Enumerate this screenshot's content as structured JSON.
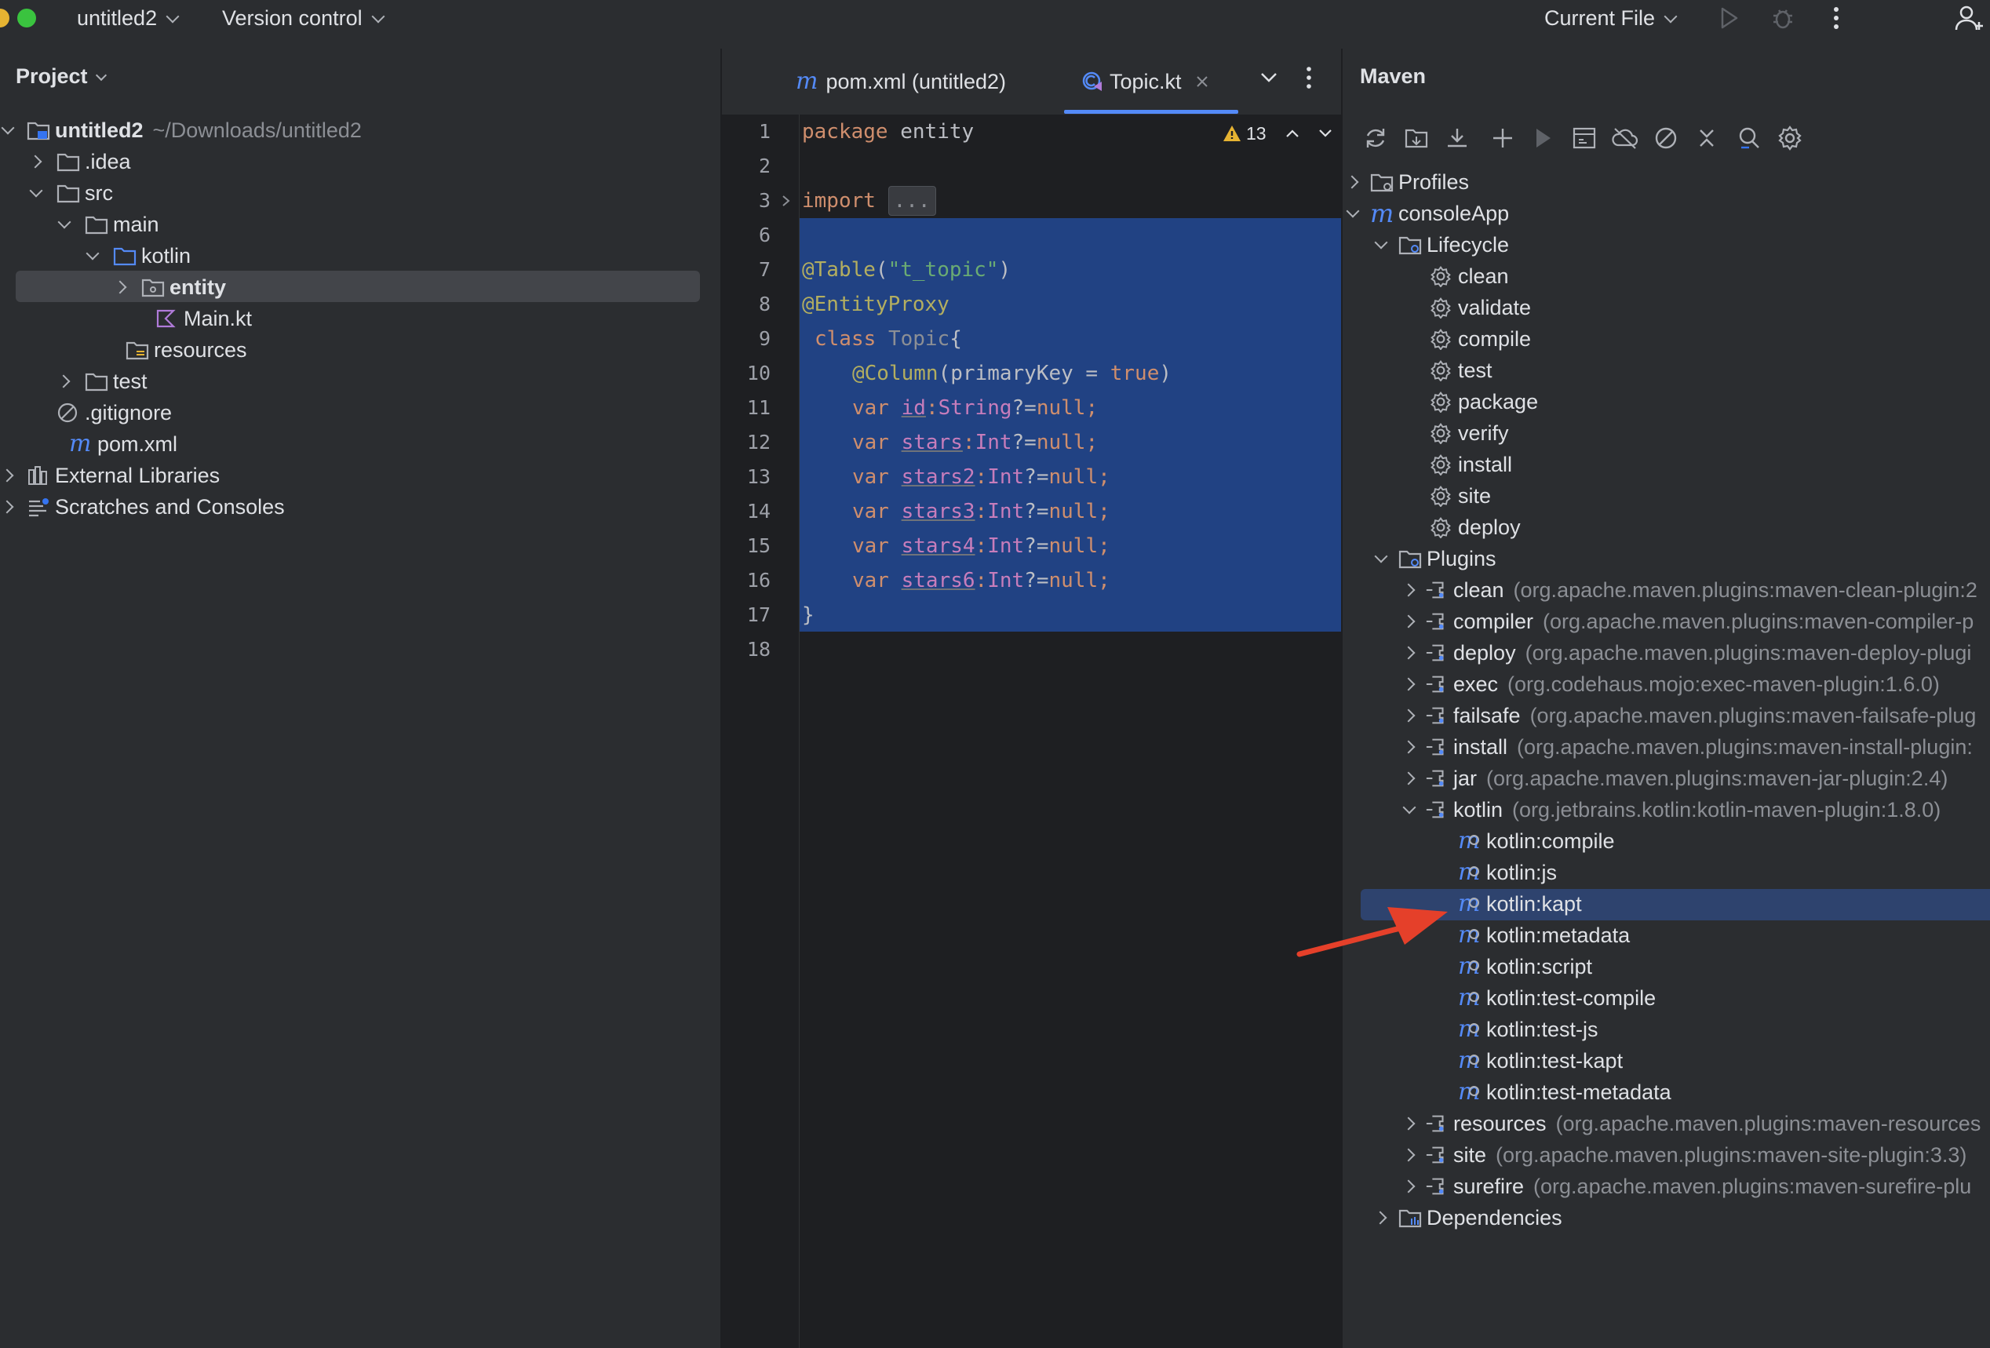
{
  "titlebar": {
    "project_name": "untitled2",
    "vcs_label": "Version control",
    "run_config": "Current File"
  },
  "project": {
    "title": "Project",
    "tree": [
      {
        "label": "untitled2",
        "path": "~/Downloads/untitled2"
      },
      {
        "label": ".idea"
      },
      {
        "label": "src"
      },
      {
        "label": "main"
      },
      {
        "label": "kotlin"
      },
      {
        "label": "entity"
      },
      {
        "label": "Main.kt"
      },
      {
        "label": "resources"
      },
      {
        "label": "test"
      },
      {
        "label": ".gitignore"
      },
      {
        "label": "pom.xml"
      },
      {
        "label": "External Libraries"
      },
      {
        "label": "Scratches and Consoles"
      }
    ]
  },
  "editor": {
    "tabs": [
      {
        "label": "pom.xml (untitled2)"
      },
      {
        "label": "Topic.kt"
      }
    ],
    "warning_count": "13",
    "line_numbers": [
      "1",
      "2",
      "3",
      "6",
      "7",
      "8",
      "9",
      "10",
      "11",
      "12",
      "13",
      "14",
      "15",
      "16",
      "17",
      "18"
    ],
    "code": {
      "l1_kw": "package",
      "l1_rest": " entity",
      "l3_kw": "import",
      "l3_fold": "...",
      "l7_ann": "@Table",
      "l7_open": "(",
      "l7_str": "\"t_topic\"",
      "l7_close": ")",
      "l8_ann": "@EntityProxy",
      "l9_kw": "class",
      "l9_name": "Topic",
      "l9_brace": "{",
      "l10_ann": "@Column",
      "l10_open": "(primaryKey = ",
      "l10_bool": "true",
      "l10_close": ")",
      "var_kw": "var",
      "fields": [
        {
          "name": "id",
          "type": "String"
        },
        {
          "name": "stars",
          "type": "Int"
        },
        {
          "name": "stars2",
          "type": "Int"
        },
        {
          "name": "stars3",
          "type": "Int"
        },
        {
          "name": "stars4",
          "type": "Int"
        },
        {
          "name": "stars6",
          "type": "Int"
        }
      ],
      "colon": ":",
      "nullable_assign": "?=",
      "null_kw": "null",
      "semi": ";",
      "l17_brace": "}"
    }
  },
  "maven": {
    "title": "Maven",
    "profiles": "Profiles",
    "project": "consoleApp",
    "lifecycle_label": "Lifecycle",
    "lifecycle": [
      "clean",
      "validate",
      "compile",
      "test",
      "package",
      "verify",
      "install",
      "site",
      "deploy"
    ],
    "plugins_label": "Plugins",
    "plugins": [
      {
        "name": "clean",
        "coord": "(org.apache.maven.plugins:maven-clean-plugin:2"
      },
      {
        "name": "compiler",
        "coord": "(org.apache.maven.plugins:maven-compiler-p"
      },
      {
        "name": "deploy",
        "coord": "(org.apache.maven.plugins:maven-deploy-plugi"
      },
      {
        "name": "exec",
        "coord": "(org.codehaus.mojo:exec-maven-plugin:1.6.0)"
      },
      {
        "name": "failsafe",
        "coord": "(org.apache.maven.plugins:maven-failsafe-plug"
      },
      {
        "name": "install",
        "coord": "(org.apache.maven.plugins:maven-install-plugin:"
      },
      {
        "name": "jar",
        "coord": "(org.apache.maven.plugins:maven-jar-plugin:2.4)"
      },
      {
        "name": "kotlin",
        "coord": "(org.jetbrains.kotlin:kotlin-maven-plugin:1.8.0)"
      }
    ],
    "kotlin_goals": [
      "kotlin:compile",
      "kotlin:js",
      "kotlin:kapt",
      "kotlin:metadata",
      "kotlin:script",
      "kotlin:test-compile",
      "kotlin:test-js",
      "kotlin:test-kapt",
      "kotlin:test-metadata"
    ],
    "plugins_after": [
      {
        "name": "resources",
        "coord": "(org.apache.maven.plugins:maven-resources"
      },
      {
        "name": "site",
        "coord": "(org.apache.maven.plugins:maven-site-plugin:3.3)"
      },
      {
        "name": "surefire",
        "coord": "(org.apache.maven.plugins:maven-surefire-plu"
      }
    ],
    "dependencies": "Dependencies"
  },
  "colors": {
    "selection_editor": "#214283",
    "selection_tree": "#2e436e",
    "annotation_arrow": "#e5402a",
    "tab_underline": "#548af7"
  }
}
